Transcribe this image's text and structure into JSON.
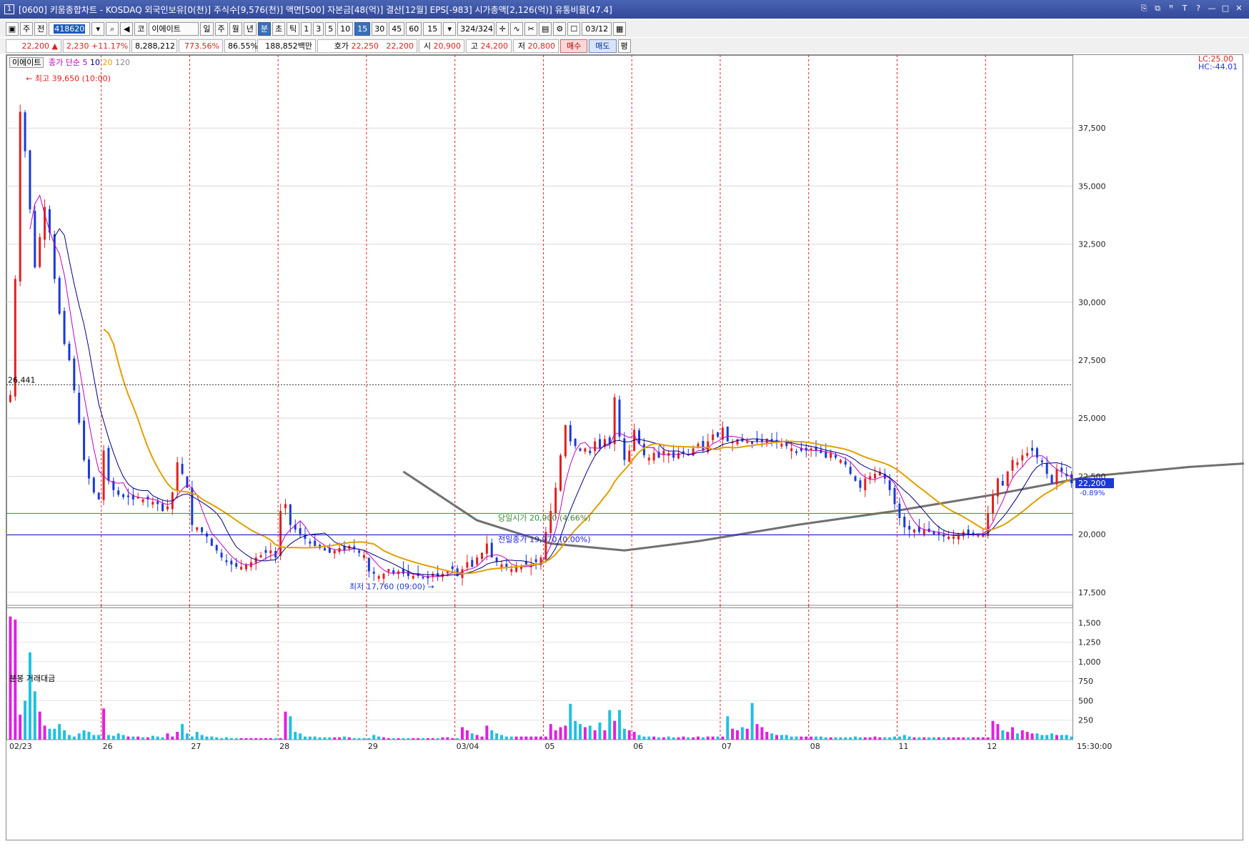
{
  "window": {
    "num": "1",
    "title": "[0600] 키움종합차트 - KOSDAQ 외국인보유[0(천)] 주식수[9,576(천)] 액면[500] 자본금[48(억)] 결산[12월] EPS[-983] 시가총액[2,126(억)] 유통비율[47.4]",
    "buttons": [
      "⎘",
      "⧉",
      "ꟸ",
      "T",
      "?",
      "—",
      "□",
      "✕"
    ]
  },
  "toolbar1": {
    "type_a": "주",
    "type_b": "전",
    "code": "418620",
    "market": "코",
    "stock_name": "이에이트",
    "periods": [
      "일",
      "주",
      "월",
      "년",
      "분",
      "초",
      "틱"
    ],
    "active_period": "분",
    "intervals": [
      "1",
      "3",
      "5",
      "10",
      "15",
      "30",
      "45",
      "60"
    ],
    "active_interval": "15",
    "interval_value": "15",
    "count": "324",
    "count_total": "/324",
    "date": "03/12"
  },
  "quote": {
    "price": "22,200",
    "arrow": "▲",
    "change": "2,230",
    "change_pct": "+11.17%",
    "volume": "8,288,212",
    "vol_ratio": "773.56%",
    "turnover": "86.55%",
    "amount": "188,852백만",
    "ask_label": "호가",
    "ask": "22,250",
    "bid": "22,200",
    "open_label": "시",
    "open": "20,900",
    "high_label": "고",
    "high": "24,200",
    "low_label": "저",
    "low": "20,800",
    "buy_label": "매수",
    "sell_label": "매도",
    "eval_label": "평"
  },
  "legend": {
    "stock": "이에이트",
    "ma_title": "종가 단순",
    "ma": [
      "5",
      "10",
      "20",
      "120"
    ],
    "volume_title": "분봉 거래대금"
  },
  "labels": {
    "lc": "LC:25.00",
    "hc": "HC:-44.01",
    "ref_price": "26,441",
    "high_note": "최고 39,650 (10:00)",
    "low_note": "최저 17,760 (09:00)",
    "open_line": "당일시가 20,900 (4.66%)",
    "prev_close_line": "전일종가 19,970 (0.00%)",
    "cur_price": "22,200",
    "cur_pct": "-0.89%",
    "time": "15:30:00"
  },
  "colors": {
    "up": "#e02020",
    "down": "#1a38d8",
    "ma5": "#c000c0",
    "ma10": "#000080",
    "ma20": "#e0a000",
    "ma120": "#707070",
    "open_line": "#3a8a3a",
    "prev_close_line": "#1a1ad0",
    "vol_up": "#e020e0",
    "vol_down": "#20c0e0"
  },
  "chart_data": {
    "type": "candlestick",
    "interval": "15분",
    "y_ticks": [
      37500,
      35000,
      32500,
      30000,
      27500,
      25000,
      22500,
      20000,
      17500
    ],
    "y_range": [
      17000,
      40400
    ],
    "x_date_labels": [
      "02/23",
      "26",
      "27",
      "28",
      "29",
      "03/04",
      "05",
      "06",
      "07",
      "08",
      "11",
      "12"
    ],
    "ref_price_line": 26441,
    "open_line": 20900,
    "prev_close_line": 19970,
    "high": 39650,
    "low": 17760,
    "last": 22200,
    "close_path": [
      {
        "d": "02/23",
        "c": [
          26000,
          31000,
          38200,
          36500,
          34000,
          31500,
          32800,
          34100,
          33000,
          31000,
          29500,
          28200,
          27500,
          26200,
          24800,
          23200,
          22400,
          21800,
          21500
        ]
      },
      {
        "d": "26",
        "c": [
          23600,
          22300,
          21900,
          21700,
          21600,
          21600,
          21500,
          21600,
          21500,
          21500,
          21400,
          21300,
          21000,
          21200,
          21800,
          23100,
          22600,
          22000
        ]
      },
      {
        "d": "27",
        "c": [
          20400,
          20300,
          20100,
          19900,
          19500,
          19300,
          19000,
          18800,
          18700,
          18600,
          18600,
          18700,
          18800,
          19000,
          19100,
          19200,
          19300,
          19000
        ]
      },
      {
        "d": "28",
        "c": [
          21000,
          21300,
          20400,
          20200,
          20000,
          19800,
          19600,
          19500,
          19400,
          19300,
          19200,
          19300,
          19400,
          19300,
          19500,
          19400,
          19200,
          19100
        ]
      },
      {
        "d": "29",
        "c": [
          18400,
          18300,
          18200,
          18300,
          18500,
          18300,
          18400,
          18300,
          18200,
          18200,
          18200,
          18100,
          18100,
          18300,
          18200,
          18300,
          18400,
          18500
        ]
      },
      {
        "d": "03/04",
        "c": [
          18200,
          18500,
          18800,
          18600,
          19000,
          19200,
          19600,
          19000,
          18800,
          18700,
          18600,
          18500,
          18600,
          18600,
          18700,
          18700,
          18800,
          19000
        ]
      },
      {
        "d": "05",
        "c": [
          20100,
          21000,
          22000,
          23400,
          24700,
          24000,
          23800,
          23600,
          23700,
          23500,
          24000,
          23700,
          24100,
          23900,
          25900,
          24200,
          23200,
          23600
        ]
      },
      {
        "d": "06",
        "c": [
          24500,
          23900,
          23400,
          23300,
          23500,
          23300,
          23600,
          23500,
          23300,
          23500,
          23500,
          23400,
          23700,
          23900,
          23600,
          24000,
          24300,
          24200
        ]
      },
      {
        "d": "07",
        "c": [
          24600,
          24000,
          24000,
          24100,
          24000,
          24000,
          23900,
          24000,
          24000,
          24100,
          24000,
          24000,
          23900,
          23800,
          23700,
          23500,
          23600,
          23600
        ]
      },
      {
        "d": "08",
        "c": [
          23700,
          23600,
          23500,
          23300,
          23500,
          23300,
          23200,
          23000,
          22600,
          22300,
          22000,
          22400,
          22500,
          22600,
          22700,
          22400,
          21900,
          21300
        ]
      },
      {
        "d": "11",
        "c": [
          20700,
          20300,
          20200,
          20200,
          20100,
          20200,
          20100,
          20000,
          20000,
          19900,
          19900,
          19900,
          20000,
          20100,
          20000,
          20000,
          20000,
          20000
        ]
      },
      {
        "d": "12",
        "c": [
          20900,
          21700,
          22400,
          22100,
          22700,
          23200,
          23100,
          23400,
          23500,
          23600,
          23300,
          23100,
          22600,
          22200,
          22800,
          22700,
          22500,
          22200
        ]
      }
    ],
    "ma120_path": [
      {
        "bar": 80,
        "v": 22700
      },
      {
        "bar": 95,
        "v": 20600
      },
      {
        "bar": 110,
        "v": 19600
      },
      {
        "bar": 125,
        "v": 19300
      },
      {
        "bar": 140,
        "v": 19700
      },
      {
        "bar": 160,
        "v": 20400
      },
      {
        "bar": 180,
        "v": 21000
      },
      {
        "bar": 200,
        "v": 21700
      },
      {
        "bar": 220,
        "v": 22500
      },
      {
        "bar": 240,
        "v": 22900
      },
      {
        "bar": 255,
        "v": 23100
      },
      {
        "bar": 275,
        "v": 22900
      },
      {
        "bar": 290,
        "v": 22700
      },
      {
        "bar": 305,
        "v": 22600
      },
      {
        "bar": 320,
        "v": 22500
      }
    ],
    "volume": {
      "y_ticks": [
        1500,
        1250,
        1000,
        750,
        500,
        250
      ],
      "y_range": [
        0,
        1650
      ],
      "unit": "백만",
      "values": [
        1580,
        1540,
        320,
        500,
        1120,
        620,
        360,
        180,
        140,
        140,
        200,
        120,
        60,
        40,
        80,
        120,
        100,
        60,
        60,
        400,
        60,
        50,
        80,
        60,
        40,
        40,
        40,
        30,
        30,
        50,
        40,
        30,
        80,
        40,
        100,
        200,
        80,
        40,
        100,
        60,
        40,
        40,
        30,
        20,
        30,
        20,
        20,
        20,
        20,
        20,
        20,
        20,
        20,
        20,
        20,
        20,
        360,
        300,
        100,
        80,
        40,
        40,
        40,
        30,
        30,
        30,
        30,
        30,
        40,
        30,
        20,
        20,
        20,
        20,
        60,
        40,
        30,
        20,
        20,
        20,
        20,
        20,
        20,
        20,
        20,
        20,
        20,
        20,
        30,
        30,
        20,
        20,
        160,
        120,
        80,
        60,
        40,
        180,
        120,
        80,
        60,
        40,
        40,
        40,
        40,
        40,
        40,
        40,
        40,
        40,
        200,
        120,
        160,
        180,
        460,
        240,
        200,
        160,
        180,
        120,
        220,
        120,
        380,
        240,
        380,
        140,
        120,
        100,
        60,
        40,
        40,
        40,
        30,
        30,
        40,
        30,
        30,
        40,
        30,
        30,
        40,
        30,
        40,
        40,
        40,
        40,
        300,
        140,
        120,
        160,
        140,
        470,
        200,
        160,
        100,
        80,
        60,
        60,
        60,
        40,
        40,
        40,
        40,
        40,
        40,
        40,
        30,
        30,
        30,
        30,
        30,
        30,
        40,
        30,
        30,
        30,
        40,
        30,
        30,
        30,
        40,
        40,
        60,
        40,
        30,
        30,
        30,
        30,
        30,
        30,
        30,
        30,
        30,
        30,
        30,
        30,
        30,
        30,
        30,
        30,
        240,
        200,
        120,
        100,
        160,
        80,
        120,
        100,
        80,
        80,
        60,
        60,
        80,
        60,
        60,
        60,
        40,
        40
      ]
    }
  }
}
